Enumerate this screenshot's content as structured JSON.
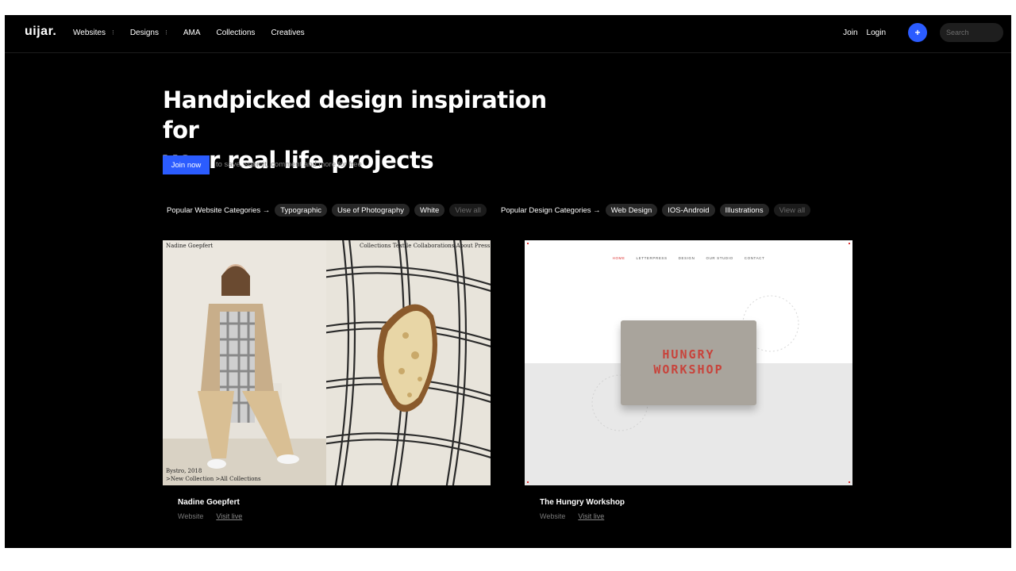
{
  "header": {
    "logo": "uijar.",
    "nav": [
      {
        "label": "Websites",
        "dropdown": true
      },
      {
        "label": "Designs",
        "dropdown": true
      },
      {
        "label": "AMA",
        "dropdown": false
      },
      {
        "label": "Collections",
        "dropdown": false
      },
      {
        "label": "Creatives",
        "dropdown": false
      }
    ],
    "join": "Join",
    "login": "Login",
    "plus": "+",
    "search_placeholder": "Search"
  },
  "hero": {
    "title_line1": "Handpicked design inspiration for",
    "title_line2": "your real life projects",
    "join_button": "Join now",
    "join_note": "to save, submit, comment and more for free"
  },
  "website_categories": {
    "label": "Popular Website Categories →",
    "chips": [
      "Typographic",
      "Use of Photography",
      "White"
    ],
    "view_all": "View all"
  },
  "design_categories": {
    "label": "Popular Design Categories →",
    "chips": [
      "Web Design",
      "IOS-Android",
      "Illustrations"
    ],
    "view_all": "View all"
  },
  "cards": [
    {
      "title": "Nadine Goepfert",
      "type": "Website",
      "visit": "Visit live",
      "thumb": {
        "name": "Nadine Goepfert",
        "nav": "Collections  Textile  Collaborations  About  Press",
        "caption": "Bystro, 2018",
        "links": ">New Collection  >All Collections"
      }
    },
    {
      "title": "The Hungry Workshop",
      "type": "Website",
      "visit": "Visit live",
      "thumb": {
        "nav": [
          "HOME",
          "LETTERPRESS",
          "DESIGN",
          "OUR STUDIO",
          "CONTACT"
        ],
        "card_line1": "HUNGRY",
        "card_line2": "WORKSHOP"
      }
    }
  ],
  "colors": {
    "accent": "#2b5cff",
    "background": "#000000",
    "chip": "#262626",
    "brand_red": "#c8433b"
  }
}
